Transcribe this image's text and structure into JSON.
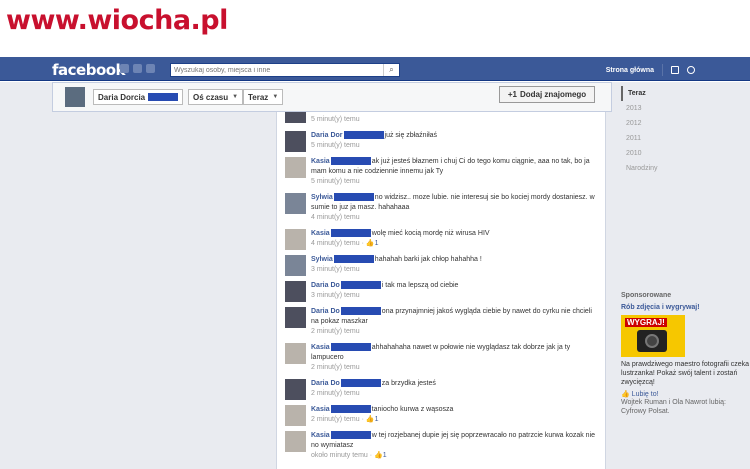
{
  "watermark": "www.wiocha.pl",
  "header": {
    "logo": "facebook",
    "search_placeholder": "Wyszukaj osoby, miejsca i inne",
    "home_label": "Strona główna"
  },
  "timeline": {
    "name": "Daria Dorcia",
    "filter": "Oś czasu",
    "period": "Teraz",
    "add_friend_label": "Dodaj znajomego"
  },
  "rightnav": {
    "items": [
      "Teraz",
      "2013",
      "2012",
      "2011",
      "2010",
      "Narodziny"
    ]
  },
  "sponsored": {
    "heading": "Sponsorowane",
    "title": "Rób zdjęcia i wygrywaj!",
    "image_label": "WYGRAJ!",
    "body": "Na prawdziwego maestro fotografii czeka lustrzanka! Pokaż swój talent i zostań zwycięzcą!",
    "like_label": "Lubię to!",
    "friends_text": "Wojtek Ruman i Ola Nawrot lubią: Cyfrowy Polsat."
  },
  "comments": [
    {
      "author": "",
      "text": "",
      "meta": "5 minut(y) temu",
      "likes": "",
      "avatar": "dark"
    },
    {
      "author": "Daria Dor",
      "text": "już się zbłaźniłaś",
      "meta": "5 minut(y) temu",
      "likes": "",
      "avatar": "dark"
    },
    {
      "author": "Kasia",
      "text": "ak już jesteś błaznem i chuj Ci do tego komu ciągnie, aaa no tak, bo ja mam komu a nie codziennie innemu jak Ty",
      "meta": "5 minut(y) temu",
      "likes": "",
      "avatar": "light"
    },
    {
      "author": "Sylwia",
      "text": "no widzisz.. moze lubie. nie interesuj sie bo kociej mordy dostaniesz. w sumie to juz ja masz. hahahaaa",
      "meta": "4 minut(y) temu",
      "likes": "",
      "avatar": "mid"
    },
    {
      "author": "Kasia",
      "text": "wolę mieć kocią mordę niż wirusa HIV",
      "meta": "4 minut(y) temu",
      "likes": "1",
      "avatar": "light"
    },
    {
      "author": "Sylwia",
      "text": "hahahah barki jak chłop hahahha !",
      "meta": "3 minut(y) temu",
      "likes": "",
      "avatar": "mid"
    },
    {
      "author": "Daria Do",
      "text": "i tak ma lepszą od ciebie",
      "meta": "3 minut(y) temu",
      "likes": "",
      "avatar": "dark"
    },
    {
      "author": "Daria Do",
      "text": "ona przynajmniej jakoś wygląda ciebie by nawet do cyrku nie chcieli na pokaz maszkar",
      "meta": "2 minut(y) temu",
      "likes": "",
      "avatar": "dark"
    },
    {
      "author": "Kasia",
      "text": "ahhahahaha nawet w połowie nie wyglądasz tak dobrze jak ja ty lampucero",
      "meta": "2 minut(y) temu",
      "likes": "",
      "avatar": "light"
    },
    {
      "author": "Daria Do",
      "text": "za brzydka jesteś",
      "meta": "2 minut(y) temu",
      "likes": "",
      "avatar": "dark"
    },
    {
      "author": "Kasia",
      "text": "taniocho kurwa z wąsosza",
      "meta": "2 minut(y) temu",
      "likes": "1",
      "avatar": "light"
    },
    {
      "author": "Kasia",
      "text": "w tej rozjebanej dupie jej się poprzewracało no patrzcie kurwa kozak nie no wymiatasz",
      "meta": "około minuty temu",
      "likes": "1",
      "avatar": "light"
    }
  ]
}
